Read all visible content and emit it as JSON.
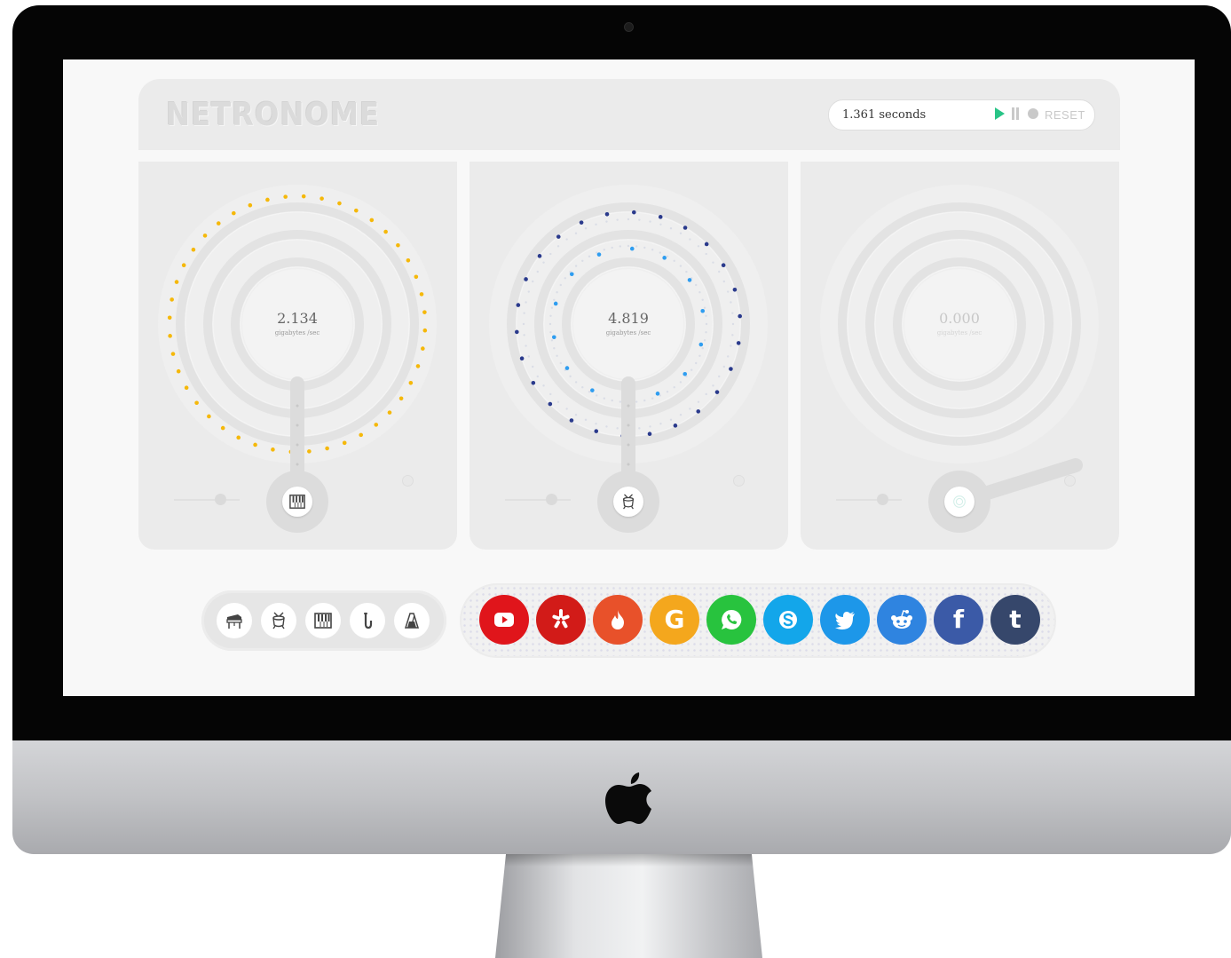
{
  "app": {
    "title": "NETRONOME"
  },
  "timer": {
    "value": "1.361 seconds",
    "play_label": "play",
    "pause_label": "pause",
    "stop_label": "stop",
    "reset_label": "RESET"
  },
  "panels": [
    {
      "value": "2.134",
      "unit": "gigabytes /sec",
      "instrument_icon": "keyboard-icon",
      "accent": "#f5b80a",
      "active": true
    },
    {
      "value": "4.819",
      "unit": "gigabytes /sec",
      "instrument_icon": "drum-icon",
      "accent": "#2f6bd4",
      "active": true
    },
    {
      "value": "0.000",
      "unit": "gigabytes /sec",
      "instrument_icon": "none",
      "accent": "#d0d0d0",
      "active": false
    }
  ],
  "instruments": [
    {
      "name": "piano",
      "icon": "piano-icon"
    },
    {
      "name": "drum",
      "icon": "drum-icon"
    },
    {
      "name": "keyboard",
      "icon": "keyboard-icon"
    },
    {
      "name": "saxophone",
      "icon": "saxophone-icon"
    },
    {
      "name": "metronome",
      "icon": "metronome-icon"
    }
  ],
  "share": [
    {
      "name": "youtube",
      "icon": "youtube-icon",
      "color": "#e0151b"
    },
    {
      "name": "yelp",
      "icon": "yelp-icon",
      "color": "#d21b18"
    },
    {
      "name": "tinder",
      "icon": "flame-icon",
      "color": "#e8512a"
    },
    {
      "name": "google",
      "icon": "google-icon",
      "color": "#f4a71d"
    },
    {
      "name": "whatsapp",
      "icon": "whatsapp-icon",
      "color": "#28c33e"
    },
    {
      "name": "skype",
      "icon": "skype-icon",
      "color": "#13a6ea"
    },
    {
      "name": "twitter",
      "icon": "twitter-icon",
      "color": "#1d97e9"
    },
    {
      "name": "reddit",
      "icon": "reddit-icon",
      "color": "#2f84e0"
    },
    {
      "name": "facebook",
      "icon": "facebook-icon",
      "color": "#3b5aa7"
    },
    {
      "name": "tumblr",
      "icon": "tumblr-icon",
      "color": "#36476b"
    }
  ],
  "share_text": {
    "google": "G",
    "facebook": "f",
    "tumblr": "t"
  }
}
